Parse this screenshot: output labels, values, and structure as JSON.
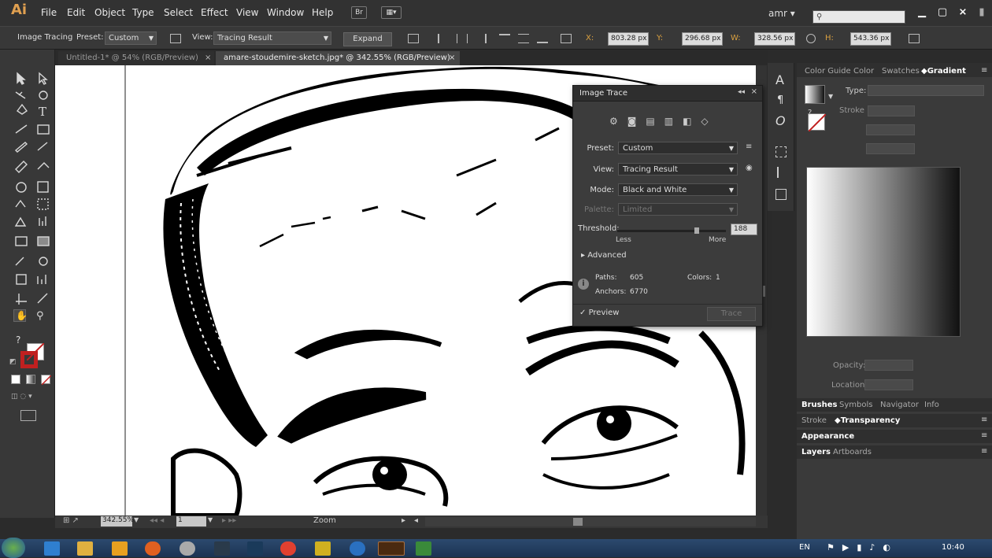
{
  "app": {
    "logo": "Ai",
    "menus": [
      "File",
      "Edit",
      "Object",
      "Type",
      "Select",
      "Effect",
      "View",
      "Window",
      "Help"
    ],
    "bridge_label": "Br",
    "user": "amr",
    "search_placeholder": ""
  },
  "control_bar": {
    "mode_label": "Image Tracing",
    "preset_label": "Preset:",
    "preset_value": "Custom",
    "view_label": "View:",
    "view_value": "Tracing Result",
    "expand_label": "Expand",
    "x_label": "X:",
    "x_value": "803.28 px",
    "y_label": "Y:",
    "y_value": "296.68 px",
    "w_label": "W:",
    "w_value": "328.56 px",
    "h_label": "H:",
    "h_value": "543.36 px"
  },
  "tabs": [
    {
      "label": "Untitled-1* @ 54% (RGB/Preview)",
      "active": false
    },
    {
      "label": "amare-stoudemire-sketch.jpg* @ 342.55% (RGB/Preview)",
      "active": true
    }
  ],
  "image_trace": {
    "title": "Image Trace",
    "preset_label": "Preset:",
    "preset_value": "Custom",
    "view_label": "View:",
    "view_value": "Tracing Result",
    "mode_label": "Mode:",
    "mode_value": "Black and White",
    "palette_label": "Palette:",
    "palette_value": "Limited",
    "threshold_label": "Threshold:",
    "threshold_value": "188",
    "threshold_fraction": 0.73,
    "less_label": "Less",
    "more_label": "More",
    "advanced_label": "Advanced",
    "paths_label": "Paths:",
    "paths_value": "605",
    "colors_label": "Colors:",
    "colors_value": "1",
    "anchors_label": "Anchors:",
    "anchors_value": "6770",
    "preview_label": "Preview",
    "preview_checked": true,
    "trace_label": "Trace"
  },
  "right_panels": {
    "top_tabs": [
      "Color Guide",
      "Color",
      "Swatches",
      "Gradient"
    ],
    "active_top_tab": "Gradient",
    "type_label": "Type:",
    "stroke_label": "Stroke",
    "opacity_label": "Opacity:",
    "location_label": "Location:",
    "brush_tabs": [
      "Brushes",
      "Symbols",
      "Navigator",
      "Info"
    ],
    "stroke_tabs": [
      "Stroke",
      "Transparency"
    ],
    "appearance_label": "Appearance",
    "layer_tabs": [
      "Layers",
      "Artboards"
    ]
  },
  "status_bar": {
    "zoom_value": "342.55%",
    "page_value": "1",
    "tool_label": "Zoom"
  },
  "taskbar": {
    "language": "EN",
    "time": "10:40"
  },
  "colors": {
    "accent_orange": "#d9a040",
    "panel_dark": "#383838",
    "taskbar_blue": "#1b3352"
  }
}
